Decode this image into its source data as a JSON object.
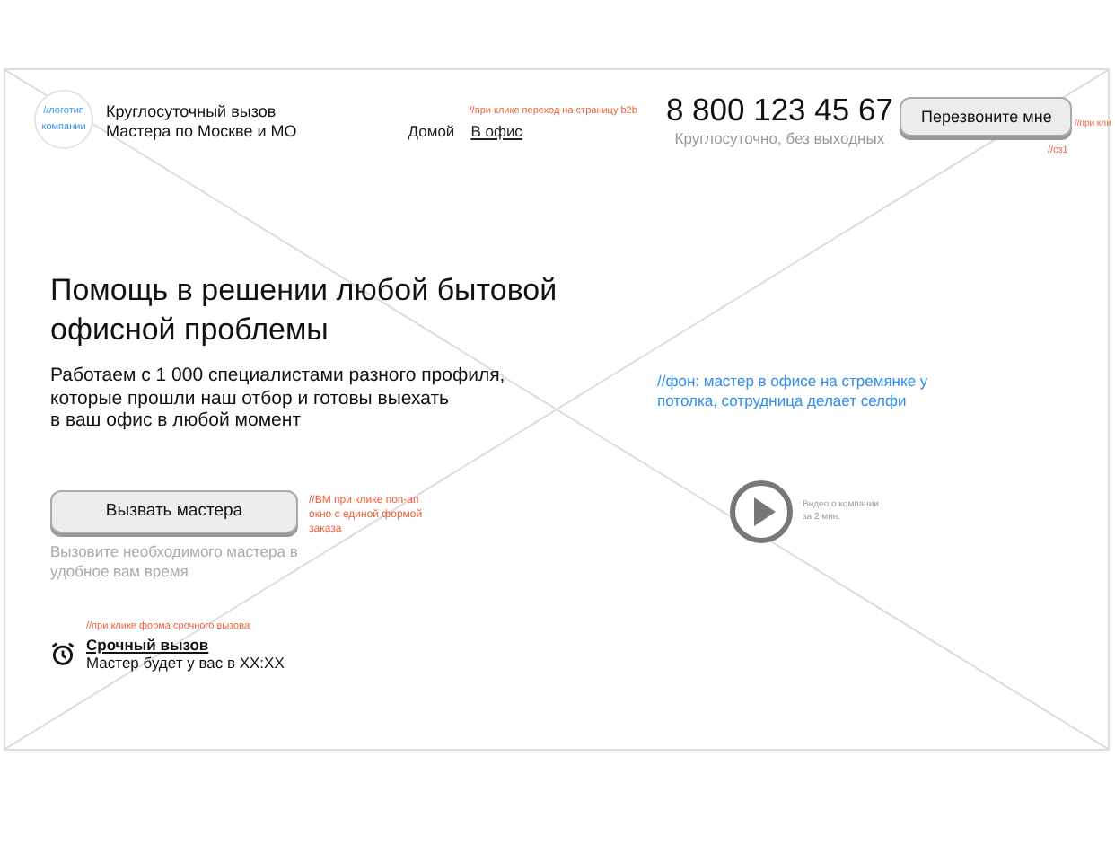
{
  "header": {
    "logo": "//логотип компании",
    "tagline": [
      "Круглосуточный вызов",
      "Мастера по Москве и МО"
    ],
    "nav": [
      {
        "label": "Домой",
        "kind": "plain"
      },
      {
        "label": "В офис",
        "kind": "link"
      }
    ],
    "nav_note": "//при клике  переход на страницу b2b",
    "phone": "8 800 123 45 67",
    "phone_note": "Круглосуточно, без выходных",
    "callback_button": "Перезвоните мне",
    "callback_notes": [
      "//при кли",
      "//сз1"
    ]
  },
  "hero": {
    "title": [
      "Помощь в решении любой бытовой",
      "офисной проблемы"
    ],
    "text": [
      "Работаем с 1 000 специалистами разного профиля,",
      "которые прошли наш отбор и готовы выехать",
      "в ваш офис в любой момент"
    ],
    "background_note": [
      "//фон: мастер в офисе на стремянке у",
      "потолка, сотрудница делает селфи"
    ],
    "cta_button": "Вызвать мастера",
    "cta_note": [
      "//ВМ при клике поп-ап",
      "окно с единой формой",
      "заказа"
    ],
    "cta_hint": [
      "Вызовите необходимого мастера в",
      "удобное вам время"
    ],
    "video_caption": [
      "Видео о компании",
      "за 2 мин."
    ],
    "urgent_note": "//при клике форма срочного вызова",
    "urgent_title": "Срочный вызов",
    "urgent_text": "Мастер будет у вас в XX:XX"
  }
}
